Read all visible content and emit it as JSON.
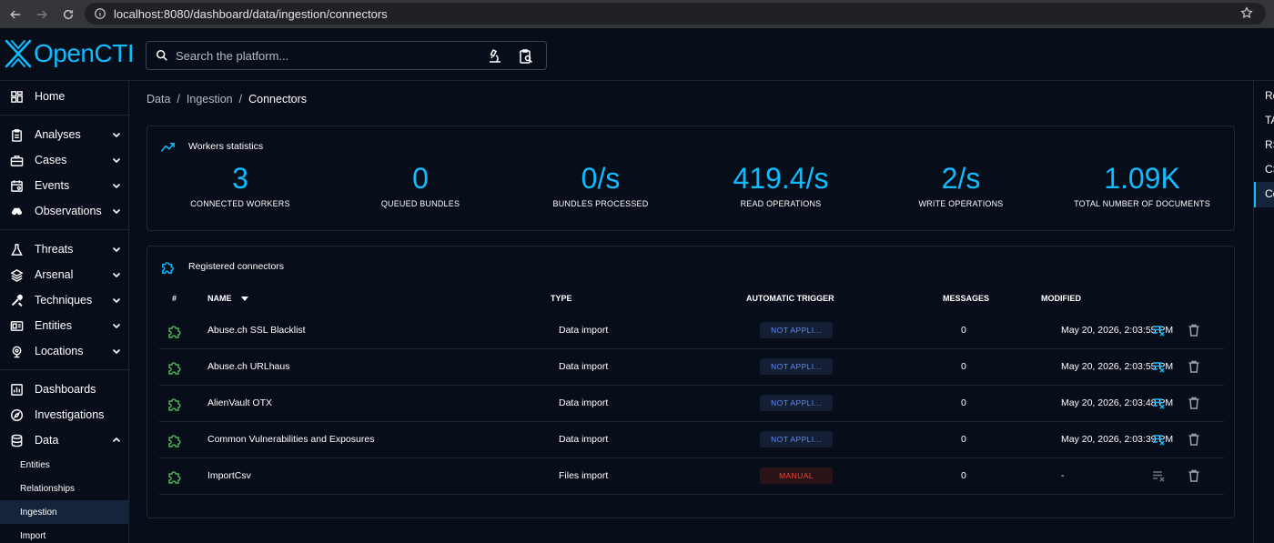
{
  "browser": {
    "url": "localhost:8080/dashboard/data/ingestion/connectors"
  },
  "app": {
    "name": "OpenCTI",
    "brand_color": "#0fbcff",
    "search_placeholder": "Search the platform..."
  },
  "sidebar": {
    "items": [
      {
        "label": "Home",
        "icon": "dashboard-icon"
      },
      {
        "label": "Analyses",
        "icon": "clipboard-icon"
      },
      {
        "label": "Cases",
        "icon": "briefcase-icon"
      },
      {
        "label": "Events",
        "icon": "calendar-icon"
      },
      {
        "label": "Observations",
        "icon": "binoculars-icon"
      },
      {
        "label": "Threats",
        "icon": "flask-icon"
      },
      {
        "label": "Arsenal",
        "icon": "layers-icon"
      },
      {
        "label": "Techniques",
        "icon": "tools-icon"
      },
      {
        "label": "Entities",
        "icon": "id-card-icon"
      },
      {
        "label": "Locations",
        "icon": "globe-pin-icon"
      },
      {
        "label": "Dashboards",
        "icon": "chart-icon"
      },
      {
        "label": "Investigations",
        "icon": "compass-icon"
      },
      {
        "label": "Data",
        "icon": "database-icon"
      }
    ],
    "data_subitems": [
      {
        "label": "Entities"
      },
      {
        "label": "Relationships"
      },
      {
        "label": "Ingestion",
        "active": true
      },
      {
        "label": "Import"
      }
    ]
  },
  "breadcrumb": [
    "Data",
    "Ingestion",
    "Connectors"
  ],
  "workers": {
    "title": "Workers statistics",
    "stats": [
      {
        "value": "3",
        "label": "CONNECTED WORKERS"
      },
      {
        "value": "0",
        "label": "QUEUED BUNDLES"
      },
      {
        "value": "0/s",
        "label": "BUNDLES PROCESSED"
      },
      {
        "value": "419.4/s",
        "label": "READ OPERATIONS"
      },
      {
        "value": "2/s",
        "label": "WRITE OPERATIONS"
      },
      {
        "value": "1.09K",
        "label": "TOTAL NUMBER OF DOCUMENTS"
      }
    ]
  },
  "connectors": {
    "title": "Registered connectors",
    "columns": {
      "index": "#",
      "name": "NAME",
      "type": "TYPE",
      "trigger": "AUTOMATIC TRIGGER",
      "messages": "MESSAGES",
      "modified": "MODIFIED"
    },
    "rows": [
      {
        "name": "Abuse.ch SSL Blacklist",
        "type": "Data import",
        "trigger": "NOT APPLI...",
        "trigger_kind": "na",
        "messages": "0",
        "modified": "May 20, 2026, 2:03:55 PM"
      },
      {
        "name": "Abuse.ch URLhaus",
        "type": "Data import",
        "trigger": "NOT APPLI...",
        "trigger_kind": "na",
        "messages": "0",
        "modified": "May 20, 2026, 2:03:55 PM"
      },
      {
        "name": "AlienVault OTX",
        "type": "Data import",
        "trigger": "NOT APPLI...",
        "trigger_kind": "na",
        "messages": "0",
        "modified": "May 20, 2026, 2:03:48 PM"
      },
      {
        "name": "Common Vulnerabilities and Exposures",
        "type": "Data import",
        "trigger": "NOT APPLI...",
        "trigger_kind": "na",
        "messages": "0",
        "modified": "May 20, 2026, 2:03:39 PM"
      },
      {
        "name": "ImportCsv",
        "type": "Files import",
        "trigger": "MANUAL",
        "trigger_kind": "manual",
        "messages": "0",
        "modified": "-"
      }
    ]
  },
  "right_nav": {
    "items": [
      "Re",
      "TA",
      "RS",
      "CS",
      "Co"
    ]
  }
}
